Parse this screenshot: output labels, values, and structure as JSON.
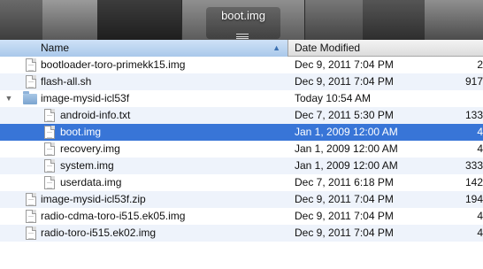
{
  "preview": {
    "title": "boot.img"
  },
  "columns": {
    "name": "Name",
    "date": "Date Modified"
  },
  "rows": [
    {
      "name": "bootloader-toro-primekk15.img",
      "date": "Dec 9, 2011 7:04 PM",
      "size": "2"
    },
    {
      "name": "flash-all.sh",
      "date": "Dec 9, 2011 7:04 PM",
      "size": "917"
    },
    {
      "name": "image-mysid-icl53f",
      "date": "Today 10:54 AM",
      "size": ""
    },
    {
      "name": "android-info.txt",
      "date": "Dec 7, 2011 5:30 PM",
      "size": "133"
    },
    {
      "name": "boot.img",
      "date": "Jan 1, 2009 12:00 AM",
      "size": "4"
    },
    {
      "name": "recovery.img",
      "date": "Jan 1, 2009 12:00 AM",
      "size": "4"
    },
    {
      "name": "system.img",
      "date": "Jan 1, 2009 12:00 AM",
      "size": "333"
    },
    {
      "name": "userdata.img",
      "date": "Dec 7, 2011 6:18 PM",
      "size": "142"
    },
    {
      "name": "image-mysid-icl53f.zip",
      "date": "Dec 9, 2011 7:04 PM",
      "size": "194"
    },
    {
      "name": "radio-cdma-toro-i515.ek05.img",
      "date": "Dec 9, 2011 7:04 PM",
      "size": "4"
    },
    {
      "name": "radio-toro-i515.ek02.img",
      "date": "Dec 9, 2011 7:04 PM",
      "size": "4"
    }
  ],
  "colors": {
    "selection": "#3875d7",
    "header_sorted": "#a9c8ea",
    "alt_row": "#eef3fb"
  },
  "icons": {
    "file": "document-icon",
    "folder": "folder-icon",
    "disclosure_open": "triangle-down-icon",
    "sort": "sort-ascending-icon"
  }
}
